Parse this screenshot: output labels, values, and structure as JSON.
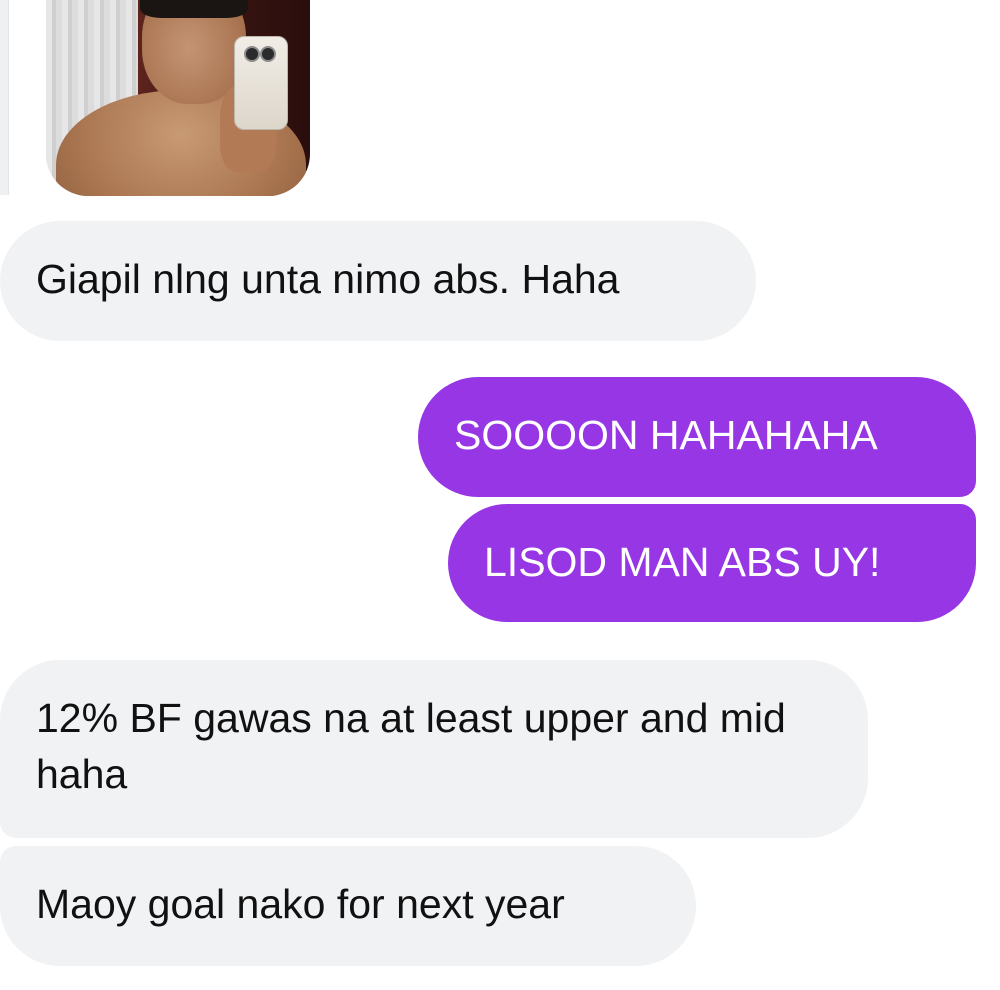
{
  "conversation": {
    "photo": {
      "description_icon": "photo-attachment"
    },
    "messages": [
      {
        "side": "incoming",
        "text": "Giapil nlng unta nimo abs. Haha"
      },
      {
        "side": "outgoing",
        "text": "SOOOON HAHAHAHA"
      },
      {
        "side": "outgoing",
        "text": "LISOD MAN ABS UY!"
      },
      {
        "side": "incoming",
        "text": "12% BF gawas na at least upper and mid haha"
      },
      {
        "side": "incoming",
        "text": "Maoy goal nako for next year"
      }
    ]
  },
  "colors": {
    "incoming_bubble": "#f1f2f4",
    "outgoing_bubble": "#9636e5",
    "incoming_text": "#111111",
    "outgoing_text": "#ffffff"
  }
}
